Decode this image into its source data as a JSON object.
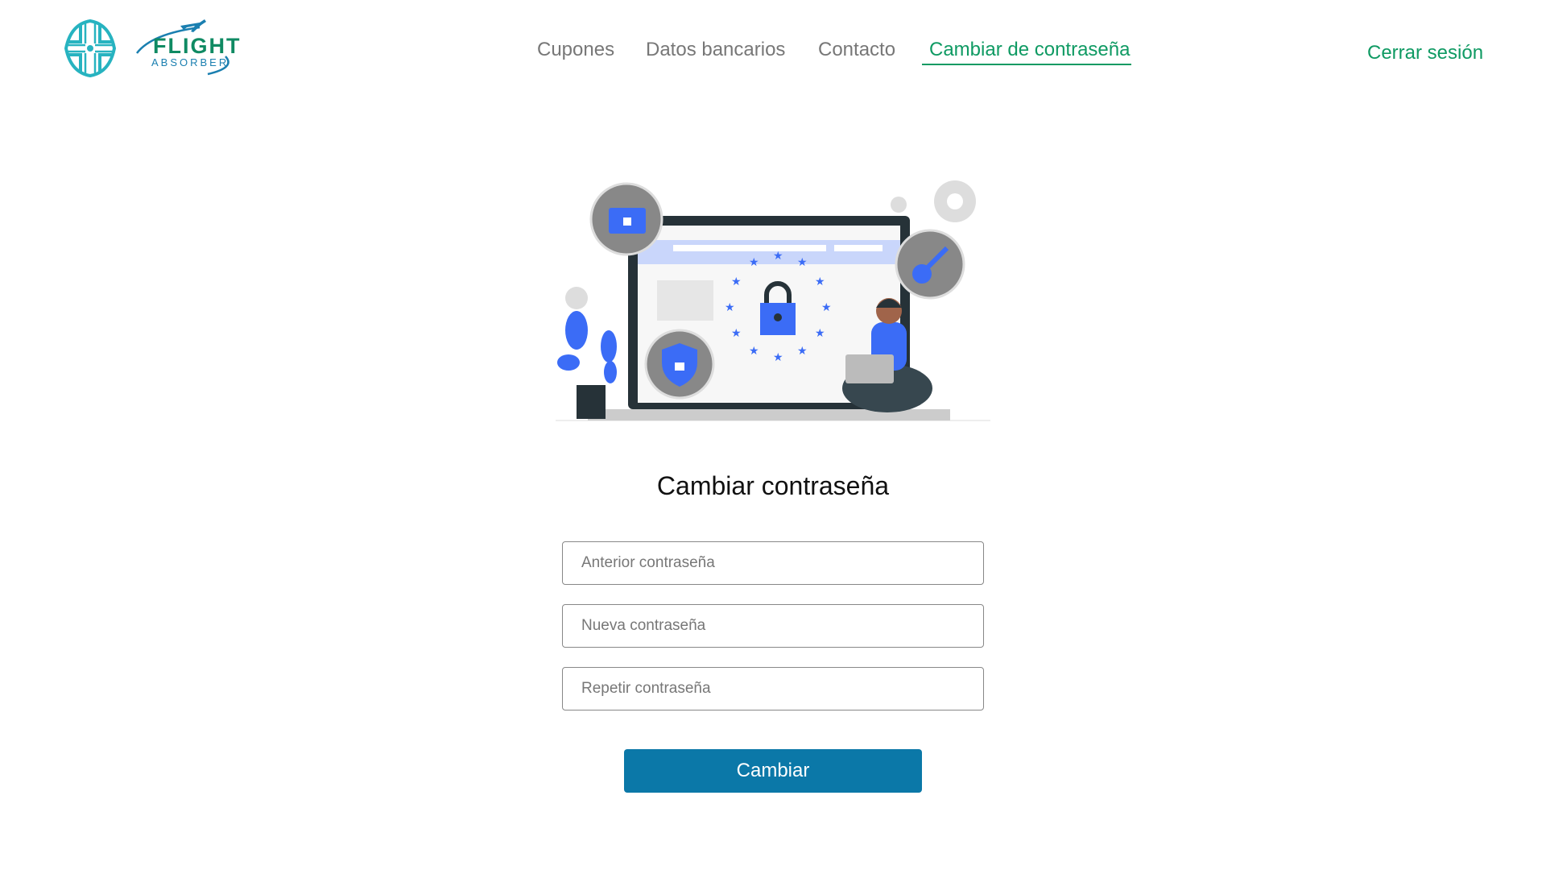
{
  "brand": {
    "name": "FLIGHT",
    "subtitle": "ABSORBER"
  },
  "nav": {
    "items": [
      {
        "label": "Cupones"
      },
      {
        "label": "Datos bancarios"
      },
      {
        "label": "Contacto"
      },
      {
        "label": "Cambiar de contraseña",
        "active": true
      }
    ],
    "logout": "Cerrar sesión"
  },
  "form": {
    "title": "Cambiar contraseña",
    "old_placeholder": "Anterior contraseña",
    "new_placeholder": "Nueva contraseña",
    "repeat_placeholder": "Repetir contraseña",
    "submit": "Cambiar"
  },
  "colors": {
    "accent": "#0f9a63",
    "button": "#0b78a8",
    "illustration": "#3b6cf6"
  }
}
